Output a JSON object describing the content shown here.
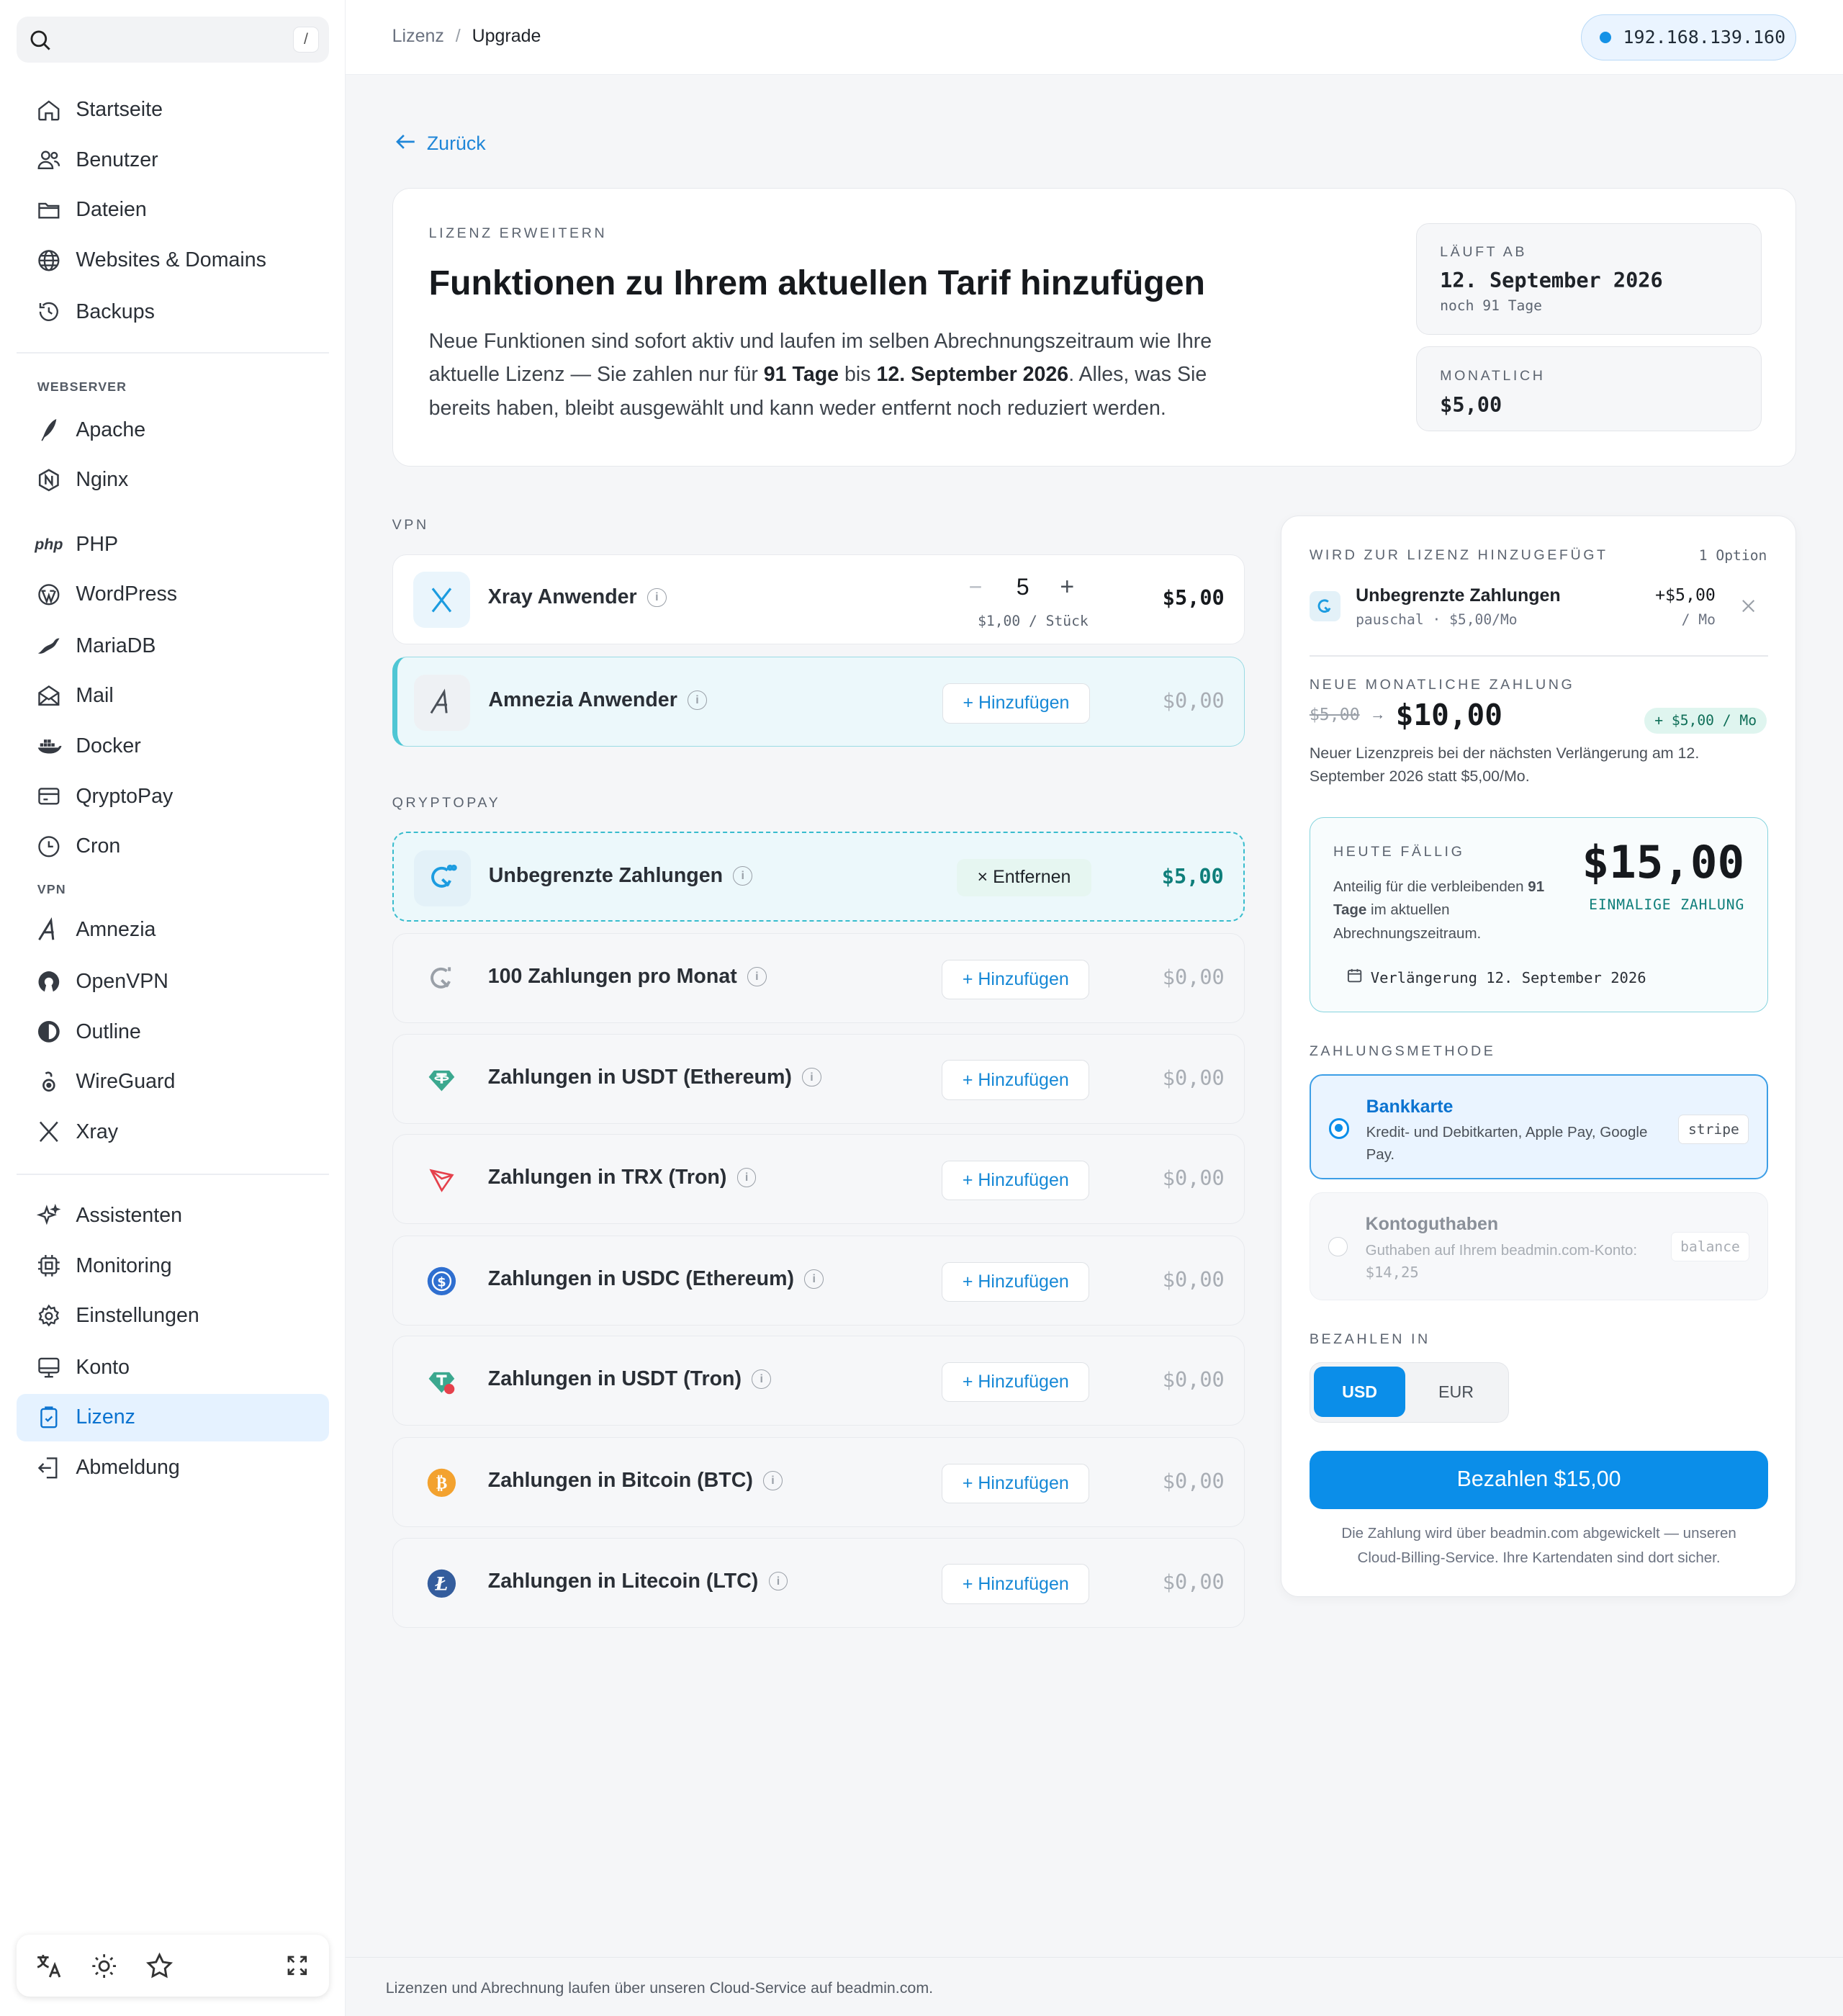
{
  "sidebar": {
    "search": {
      "shortcut": "/"
    },
    "main": [
      {
        "label": "Startseite",
        "icon": "home-icon"
      },
      {
        "label": "Benutzer",
        "icon": "users-icon"
      },
      {
        "label": "Dateien",
        "icon": "folder-icon"
      },
      {
        "label": "Websites & Domains",
        "icon": "globe-icon"
      },
      {
        "label": "Backups",
        "icon": "history-icon"
      }
    ],
    "webserver_label": "WEBSERVER",
    "webserver": [
      {
        "label": "Apache",
        "icon": "feather-icon"
      },
      {
        "label": "Nginx",
        "icon": "nginx-icon"
      }
    ],
    "apps": [
      {
        "label": "PHP",
        "icon": "php-icon",
        "glyph": "php"
      },
      {
        "label": "WordPress",
        "icon": "wordpress-icon"
      },
      {
        "label": "MariaDB",
        "icon": "mariadb-icon"
      },
      {
        "label": "Mail",
        "icon": "mail-icon"
      },
      {
        "label": "Docker",
        "icon": "docker-icon"
      },
      {
        "label": "QryptoPay",
        "icon": "wallet-icon"
      },
      {
        "label": "Cron",
        "icon": "clock-icon"
      }
    ],
    "vpn_label": "VPN",
    "vpn": [
      {
        "label": "Amnezia",
        "icon": "amnezia-icon"
      },
      {
        "label": "OpenVPN",
        "icon": "openvpn-icon"
      },
      {
        "label": "Outline",
        "icon": "outline-icon"
      },
      {
        "label": "WireGuard",
        "icon": "wireguard-icon"
      },
      {
        "label": "Xray",
        "icon": "xray-icon"
      }
    ],
    "system": [
      {
        "label": "Assistenten",
        "icon": "sparkles-icon"
      },
      {
        "label": "Monitoring",
        "icon": "chip-icon"
      },
      {
        "label": "Einstellungen",
        "icon": "gear-icon"
      },
      {
        "label": "Konto",
        "icon": "monitor-icon"
      },
      {
        "label": "Lizenz",
        "icon": "license-icon",
        "active": true
      },
      {
        "label": "Abmeldung",
        "icon": "logout-icon"
      }
    ]
  },
  "topbar": {
    "crumb_parent": "Lizenz",
    "crumb_sep": "/",
    "crumb_current": "Upgrade",
    "ip": "192.168.139.160"
  },
  "back": "Zurück",
  "hero": {
    "eyebrow": "LIZENZ ERWEITERN",
    "title": "Funktionen zu Ihrem aktuellen Tarif hinzufügen",
    "d1": "Neue Funktionen sind sofort aktiv und laufen im selben Abrechnungszeitraum wie Ihre aktuelle Lizenz — Sie zahlen nur für ",
    "d_days": "91 Tage",
    "d2": " bis ",
    "d_date": "12. September 2026",
    "d3": ". Alles, was Sie bereits haben, bleibt ausgewählt und kann weder entfernt noch reduziert werden.",
    "expires_label": "LÄUFT AB",
    "expires_value": "12. September 2026",
    "expires_sub": "noch 91 Tage",
    "monthly_label": "MONATLICH",
    "monthly_value": "$5,00"
  },
  "vpn_section": "VPN",
  "vpn_rows": [
    {
      "name": "Xray Anwender",
      "qty": "5",
      "unit": "$1,00 / Stück",
      "minus": "−",
      "plus": "+",
      "price": "$5,00"
    },
    {
      "name": "Amnezia Anwender",
      "btn": "+ Hinzufügen",
      "price": "$0,00"
    }
  ],
  "qp_section": "QRYPTOPAY",
  "qp_rows": [
    {
      "name": "Unbegrenzte Zahlungen",
      "btn": "× Entfernen",
      "price": "$5,00"
    },
    {
      "name": "100 Zahlungen pro Monat",
      "btn": "+ Hinzufügen",
      "price": "$0,00"
    },
    {
      "name": "Zahlungen in USDT (Ethereum)",
      "btn": "+ Hinzufügen",
      "price": "$0,00"
    },
    {
      "name": "Zahlungen in TRX (Tron)",
      "btn": "+ Hinzufügen",
      "price": "$0,00"
    },
    {
      "name": "Zahlungen in USDC (Ethereum)",
      "btn": "+ Hinzufügen",
      "price": "$0,00"
    },
    {
      "name": "Zahlungen in USDT (Tron)",
      "btn": "+ Hinzufügen",
      "price": "$0,00"
    },
    {
      "name": "Zahlungen in Bitcoin (BTC)",
      "btn": "+ Hinzufügen",
      "price": "$0,00"
    },
    {
      "name": "Zahlungen in Litecoin (LTC)",
      "btn": "+ Hinzufügen",
      "price": "$0,00"
    }
  ],
  "info_glyph": "i",
  "panel": {
    "added_label": "WIRD ZUR LIZENZ HINZUGEFÜGT",
    "added_count": "1 Option",
    "item_name": "Unbegrenzte Zahlungen",
    "item_sub": "pauschal · $5,00/Mo",
    "item_price": "+$5,00",
    "item_per": "/ Mo",
    "new_label": "NEUE MONATLICHE ZAHLUNG",
    "old_price": "$5,00",
    "arrow": "→",
    "new_price": "$10,00",
    "delta": "+ $5,00 / Mo",
    "new_note": "Neuer Lizenzpreis bei der nächsten Verlängerung am 12. September 2026 statt $5,00/Mo.",
    "due_label": "HEUTE FÄLLIG",
    "due_note1": "Anteilig für die verbleibenden ",
    "due_note_b": "91 Tage",
    "due_note2": " im aktuellen Abrechnungszeitraum.",
    "due_amount": "$15,00",
    "due_once": "EINMALIGE ZAHLUNG",
    "renewal": "Verlängerung 12. September 2026",
    "method_label": "ZAHLUNGSMETHODE",
    "card_title": "Bankkarte",
    "card_desc": "Kredit- und Debitkarten, Apple Pay, Google Pay.",
    "card_tag": "stripe",
    "bal_title": "Kontoguthaben",
    "bal_desc": "Guthaben auf Ihrem beadmin.com-Konto:",
    "bal_amount": "$14,25",
    "bal_tag": "balance",
    "pay_in_label": "BEZAHLEN IN",
    "usd": "USD",
    "eur": "EUR",
    "pay_btn": "Bezahlen $15,00",
    "pay_note": "Die Zahlung wird über beadmin.com abgewickelt — unseren Cloud-Billing-Service. Ihre Kartendaten sind dort sicher."
  },
  "footer": "Lizenzen und Abrechnung laufen über unseren Cloud-Service auf beadmin.com."
}
